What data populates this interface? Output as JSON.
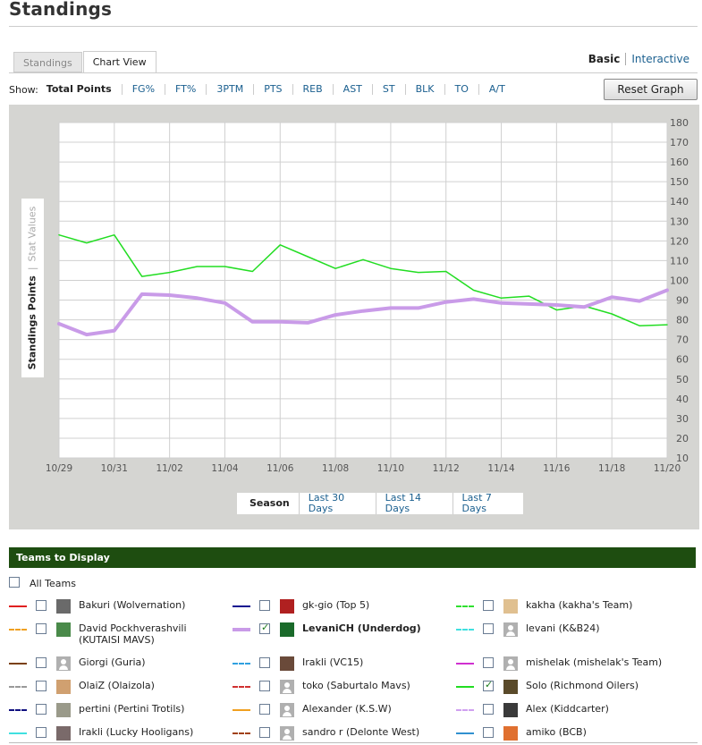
{
  "page": {
    "title": "Standings"
  },
  "tabs": [
    {
      "label": "Standings"
    },
    {
      "label": "Chart View"
    }
  ],
  "view_toggle": {
    "basic": "Basic",
    "interactive": "Interactive"
  },
  "show": {
    "label": "Show:",
    "items": [
      "Total Points",
      "FG%",
      "FT%",
      "3PTM",
      "PTS",
      "REB",
      "AST",
      "ST",
      "BLK",
      "TO",
      "A/T"
    ]
  },
  "reset_button": "Reset Graph",
  "yaxis_toggle": {
    "active": "Standings Points",
    "inactive": "Stat Values"
  },
  "ranges": [
    "Season",
    "Last 30 Days",
    "Last 14 Days",
    "Last 7 Days"
  ],
  "chart_data": {
    "type": "line",
    "x": [
      "10/29",
      "10/30",
      "10/31",
      "11/01",
      "11/02",
      "11/03",
      "11/04",
      "11/05",
      "11/06",
      "11/07",
      "11/08",
      "11/09",
      "11/10",
      "11/11",
      "11/12",
      "11/13",
      "11/14",
      "11/15",
      "11/16",
      "11/17",
      "11/18",
      "11/19",
      "11/20"
    ],
    "xticks": [
      "10/29",
      "10/31",
      "11/02",
      "11/04",
      "11/06",
      "11/08",
      "11/10",
      "11/12",
      "11/14",
      "11/16",
      "11/18",
      "11/20"
    ],
    "ylim": [
      10,
      180
    ],
    "yticks": [
      10,
      20,
      30,
      40,
      50,
      60,
      70,
      80,
      90,
      100,
      110,
      120,
      130,
      140,
      150,
      160,
      170,
      180
    ],
    "series": [
      {
        "color": "#22dd22",
        "width": 1.5,
        "values": [
          123,
          119,
          123,
          102,
          104,
          107,
          107,
          104.5,
          118,
          112,
          106,
          110.5,
          106,
          104,
          104.5,
          95,
          91,
          92,
          85,
          87,
          83,
          77,
          77.5
        ]
      },
      {
        "color": "#c99be8",
        "width": 4,
        "values": [
          78,
          72.5,
          74.5,
          93,
          92.5,
          91,
          88.5,
          79,
          79,
          78.5,
          82.5,
          84.5,
          86,
          86,
          89,
          90.5,
          88.5,
          88,
          87.5,
          86.5,
          91.5,
          89.5,
          95
        ]
      }
    ],
    "grid": true
  },
  "teams_section": {
    "header": "Teams to Display",
    "all_label": "All Teams",
    "columns": [
      [
        {
          "label": "Bakuri (Wolvernation)",
          "color": "#e02020",
          "style": "solid",
          "checked": false,
          "avatar": "#6a6a6a"
        },
        {
          "label": "David Pockhverashvili (KUTAISI MAVS)",
          "color": "#f0a020",
          "style": "dashed",
          "checked": false,
          "avatar": "#4a8a4a"
        },
        {
          "label": "Giorgi (Guria)",
          "color": "#7a4010",
          "style": "solid",
          "checked": false,
          "avatar": "default"
        },
        {
          "label": "OlaiZ (Olaizola)",
          "color": "#999999",
          "style": "dashed",
          "checked": false,
          "avatar": "#d0a070"
        },
        {
          "label": "pertini (Pertini Trotils)",
          "color": "#101080",
          "style": "dashed",
          "checked": false,
          "avatar": "#9a9a8a"
        },
        {
          "label": "Irakli (Lucky Hooligans)",
          "color": "#40e0e0",
          "style": "solid",
          "checked": false,
          "avatar": "#7a6a6a"
        }
      ],
      [
        {
          "label": "gk-gio (Top 5)",
          "color": "#101090",
          "style": "solid",
          "checked": false,
          "avatar": "#b02020"
        },
        {
          "label": "LevaniCH (Underdog)",
          "color": "#c99be8",
          "style": "thick",
          "checked": true,
          "bold": true,
          "avatar": "#1a6a2a"
        },
        {
          "label": "Irakli (VC15)",
          "color": "#30a0e0",
          "style": "dashed",
          "checked": false,
          "avatar": "#6a4a3a"
        },
        {
          "label": "toko (Saburtalo Mavs)",
          "color": "#d03030",
          "style": "dashed",
          "checked": false,
          "avatar": "default"
        },
        {
          "label": "Alexander (K.S.W)",
          "color": "#f0a020",
          "style": "solid",
          "checked": false,
          "avatar": "default"
        },
        {
          "label": "sandro r (Delonte West)",
          "color": "#a04010",
          "style": "dashed",
          "checked": false,
          "avatar": "default"
        }
      ],
      [
        {
          "label": "kakha (kakha's Team)",
          "color": "#30e030",
          "style": "dashed",
          "checked": false,
          "avatar": "#e0c090"
        },
        {
          "label": "levani (K&B24)",
          "color": "#40e0e0",
          "style": "dashed",
          "checked": false,
          "avatar": "default"
        },
        {
          "label": "mishelak (mishelak's Team)",
          "color": "#d030d0",
          "style": "solid",
          "checked": false,
          "avatar": "default"
        },
        {
          "label": "Solo (Richmond Oilers)",
          "color": "#22dd22",
          "style": "solid",
          "checked": true,
          "avatar": "#5a4a2a"
        },
        {
          "label": "Alex (Kiddcarter)",
          "color": "#d0a0f0",
          "style": "dashed",
          "checked": false,
          "avatar": "#3a3a3a"
        },
        {
          "label": "amiko (BCB)",
          "color": "#3090d0",
          "style": "solid",
          "checked": false,
          "avatar": "#e07030"
        }
      ]
    ]
  }
}
